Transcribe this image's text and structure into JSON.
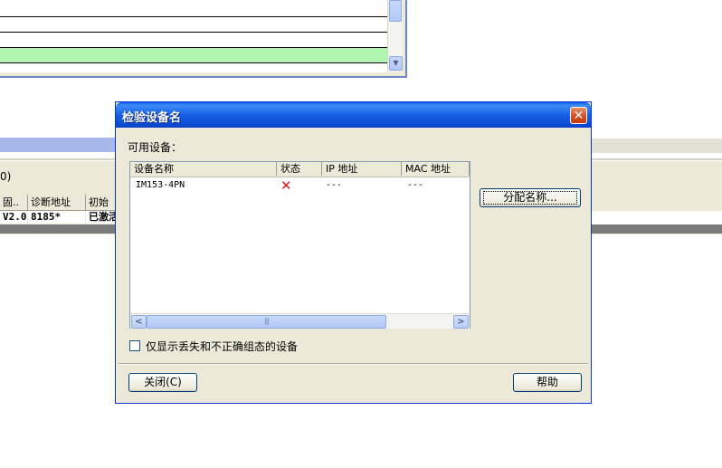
{
  "background": {
    "paren_text": "0)",
    "table_headers": [
      "固..",
      "诊断地址",
      "初始"
    ],
    "table_row": [
      "V2.0",
      "8185*",
      "已激活"
    ]
  },
  "dialog": {
    "title": "检验设备名",
    "close_glyph": "✕",
    "available_label": "可用设备：",
    "columns": [
      "设备名称",
      "状态",
      "IP 地址",
      "MAC 地址"
    ],
    "rows": [
      {
        "name": "IM153-4PN",
        "status_icon": "error-x-icon",
        "status_glyph": "✕",
        "ip": "---",
        "mac": "---"
      }
    ],
    "scroll_left": "<",
    "scroll_right": ">",
    "scroll_grip": "|||",
    "assign_button": "分配名称...",
    "checkbox_label": "仅显示丢失和不正确组态的设备",
    "checkbox_checked": false,
    "close_button": "关闭(C)",
    "help_button": "帮助"
  },
  "colors": {
    "title_bar": "#0a5ee8",
    "dialog_bg": "#ece9d8",
    "error_x": "#e01818",
    "green_row": "#b0f5b0"
  }
}
